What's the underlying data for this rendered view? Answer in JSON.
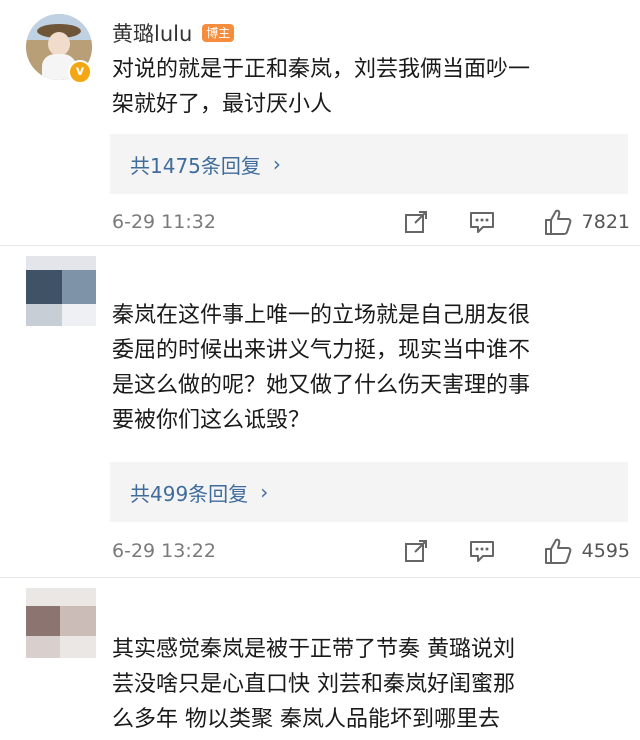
{
  "comments": [
    {
      "username": "黄璐lulu",
      "badge": "博主",
      "verified_icon": "v",
      "text_lines": [
        "对说的就是于正和秦岚，刘芸我俩当面吵一",
        "架就好了，最讨厌小人"
      ],
      "reply_label": "共1475条回复",
      "reply_chevron": "›",
      "time": "6-29 11:32",
      "likes": "7821"
    },
    {
      "username": "",
      "text_lines": [
        "秦岚在这件事上唯一的立场就是自己朋友很",
        "委屈的时候出来讲义气力挺，现实当中谁不",
        "是这么做的呢？她又做了什么伤天害理的事",
        "要被你们这么诋毁？"
      ],
      "reply_label": "共499条回复",
      "reply_chevron": "›",
      "time": "6-29 13:22",
      "likes": "4595"
    },
    {
      "username": "",
      "text_lines": [
        "其实感觉秦岚是被于正带了节奏 黄璐说刘",
        "芸没啥只是心直口快 刘芸和秦岚好闺蜜那",
        "么多年 物以类聚 秦岚人品能坏到哪里去"
      ]
    }
  ],
  "icons": {
    "share": "share-icon",
    "comment": "comment-icon",
    "like": "thumbs-up-icon"
  },
  "colors": {
    "reply_link": "#3f6c9c",
    "badge_bg": "#f58d3d",
    "verified": "#f3a712",
    "reply_box_bg": "#f4f4f4"
  }
}
